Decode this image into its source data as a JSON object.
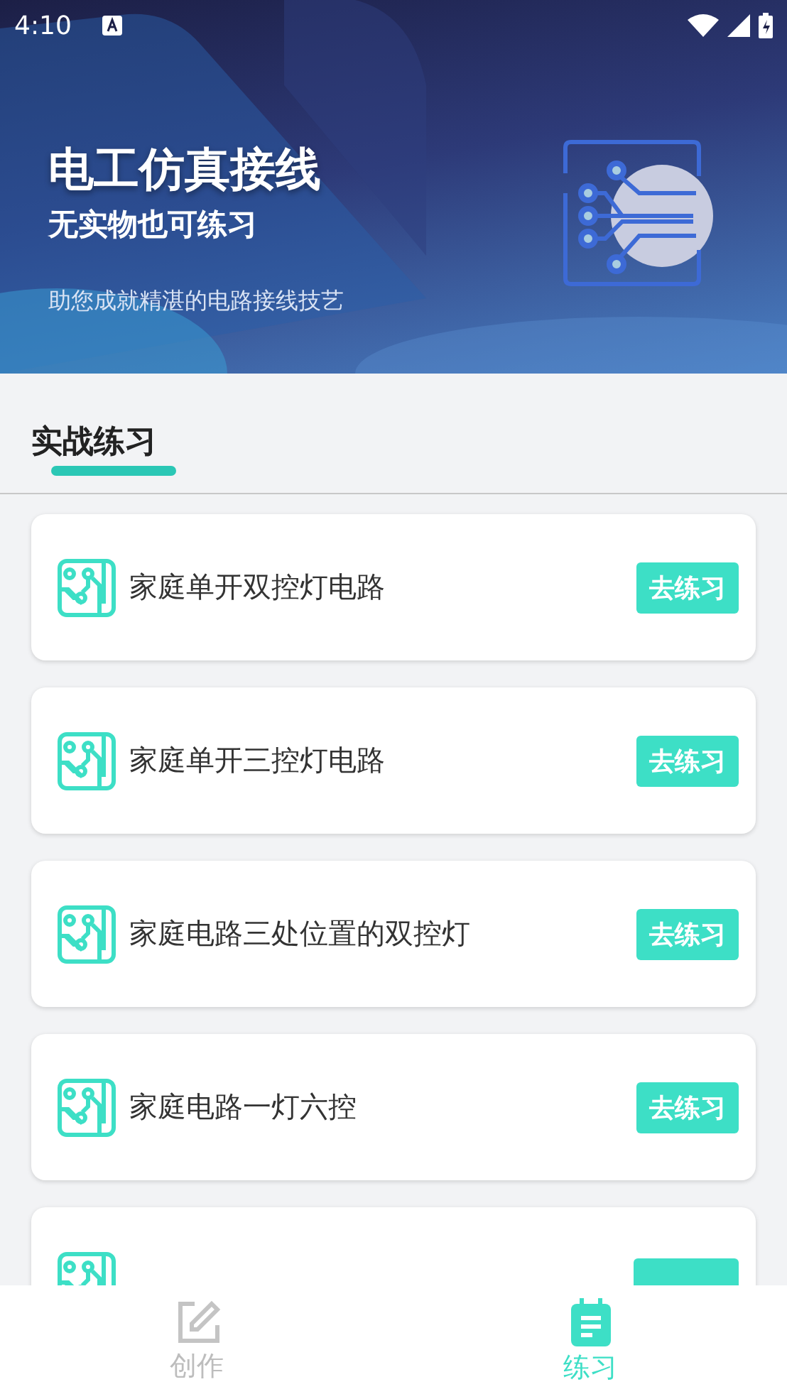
{
  "status_bar": {
    "time": "4:10"
  },
  "banner": {
    "title": "电工仿真接线",
    "subtitle": "无实物也可练习",
    "tagline": "助您成就精湛的电路接线技艺"
  },
  "section": {
    "title": "实战练习",
    "selected": true
  },
  "items": [
    {
      "title": "家庭单开双控灯电路",
      "action": "去练习"
    },
    {
      "title": "家庭单开三控灯电路",
      "action": "去练习"
    },
    {
      "title": "家庭电路三处位置的双控灯",
      "action": "去练习"
    },
    {
      "title": "家庭电路一灯六控",
      "action": "去练习"
    },
    {
      "kind": "cut"
    }
  ],
  "nav": [
    {
      "label": "创作",
      "selected": false
    },
    {
      "label": "练习",
      "selected": true
    }
  ]
}
